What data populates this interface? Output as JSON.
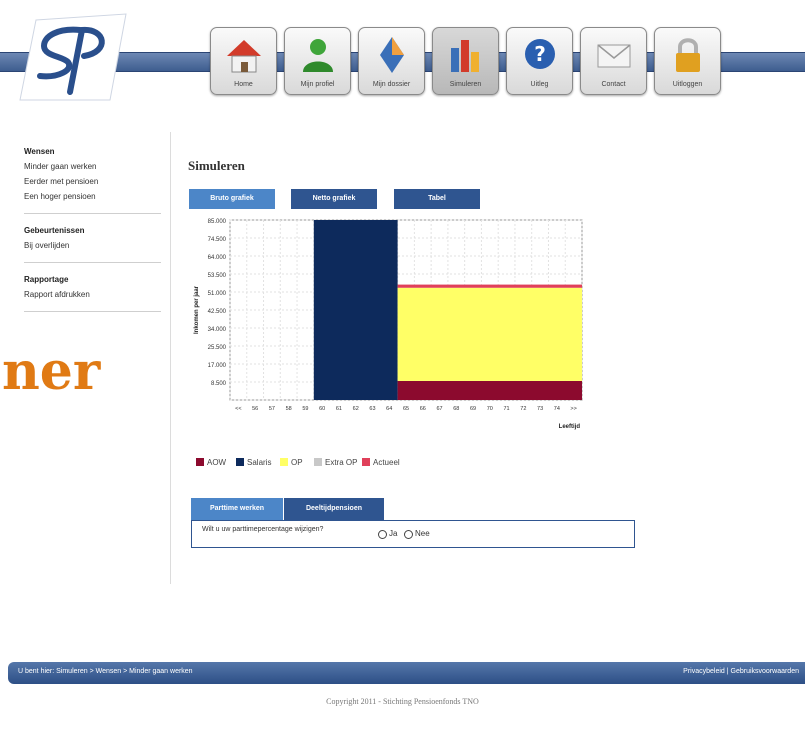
{
  "nav": {
    "items": [
      {
        "label": "Home",
        "icon": "home-icon",
        "active": false
      },
      {
        "label": "Mijn profiel",
        "icon": "user-icon",
        "active": false
      },
      {
        "label": "Mijn dossier",
        "icon": "dossier-icon",
        "active": false
      },
      {
        "label": "Simuleren",
        "icon": "bar-chart-icon",
        "active": true
      },
      {
        "label": "Uitleg",
        "icon": "help-icon",
        "active": false
      },
      {
        "label": "Contact",
        "icon": "mail-icon",
        "active": false
      },
      {
        "label": "Uitloggen",
        "icon": "lock-icon",
        "active": false
      }
    ]
  },
  "sidebar": {
    "sections": [
      {
        "heading": "Wensen",
        "links": [
          "Minder gaan werken",
          "Eerder met pensioen",
          "Een hoger pensioen"
        ]
      },
      {
        "heading": "Gebeurtenissen",
        "links": [
          "Bij overlijden"
        ]
      },
      {
        "heading": "Rapportage",
        "links": [
          "Rapport afdrukken"
        ]
      }
    ]
  },
  "cropped_heading": "ner",
  "main": {
    "title": "Simuleren",
    "tabs": [
      {
        "label": "Bruto grafiek",
        "active": true
      },
      {
        "label": "Netto grafiek",
        "active": false
      },
      {
        "label": "Tabel",
        "active": false
      }
    ]
  },
  "chart_data": {
    "type": "area",
    "ylabel": "Inkomen per jaar",
    "xlabel": "Leeftijd",
    "y_ticks": [
      "85.000",
      "74.500",
      "64.000",
      "53.500",
      "51.000",
      "42.500",
      "34.000",
      "25.500",
      "17.000",
      "8.500"
    ],
    "x_ticks": [
      "<<",
      "56",
      "57",
      "58",
      "59",
      "60",
      "61",
      "62",
      "63",
      "64",
      "65",
      "66",
      "67",
      "68",
      "69",
      "70",
      "71",
      "72",
      "73",
      "74",
      ">>"
    ],
    "segments": [
      {
        "name": "Salaris",
        "color": "#0d2a5c",
        "from_age": 60,
        "to_age": 65,
        "bottom": 0,
        "top": 85000
      },
      {
        "name": "AOW",
        "color": "#8c0a2e",
        "from_age": 65,
        "to_age": 75,
        "bottom": 0,
        "top": 9000
      },
      {
        "name": "OP",
        "color": "#ffff66",
        "from_age": 65,
        "to_age": 75,
        "bottom": 9000,
        "top": 53000
      },
      {
        "name": "Actueel",
        "color": "#e0405a",
        "from_age": 65,
        "to_age": 75,
        "bottom": 53000,
        "top": 54500
      }
    ],
    "grid": true,
    "legend": [
      {
        "label": "AOW",
        "color": "#8c0a2e"
      },
      {
        "label": "Salaris",
        "color": "#0d2a5c"
      },
      {
        "label": "OP",
        "color": "#ffff66"
      },
      {
        "label": "Extra OP",
        "color": "#c8c8c8"
      },
      {
        "label": "Actueel",
        "color": "#e0405a"
      }
    ]
  },
  "bottom_tabs": [
    {
      "label": "Parttime werken",
      "active": true
    },
    {
      "label": "Deeltijdpensioen",
      "active": false
    }
  ],
  "question": {
    "text": "Wilt u uw parttimepercentage wijzigen?",
    "option_yes": "Ja",
    "option_no": "Nee"
  },
  "footer": {
    "breadcrumb": "U bent hier: Simuleren > Wensen > Minder gaan werken",
    "links": "Privacybeleid | Gebruiksvoorwaarden",
    "copyright": "Copyright 2011 - Stichting Pensioenfonds TNO"
  }
}
